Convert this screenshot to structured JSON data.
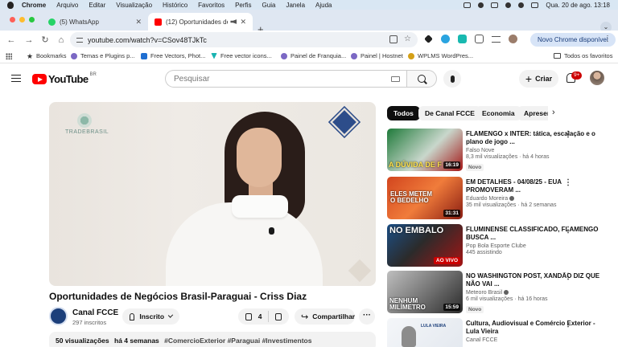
{
  "menubar": {
    "items": [
      "Chrome",
      "Arquivo",
      "Editar",
      "Visualização",
      "Histórico",
      "Favoritos",
      "Perfis",
      "Guia",
      "Janela",
      "Ajuda"
    ],
    "datetime": "Qua. 20 de ago.  13:18"
  },
  "tabs": [
    {
      "title": "(5) WhatsApp",
      "favicon_color": "#25d366"
    },
    {
      "title": "(12) Oportunidades de Ne",
      "favicon_color": "#ff0000"
    }
  ],
  "tabstrip": {
    "new_tab": "+",
    "menu": "⌄"
  },
  "toolbar": {
    "url": "youtube.com/watch?v=CSov48TJkTc",
    "new_chrome": "Novo Chrome disponível"
  },
  "bookmarks": {
    "items": [
      {
        "label": "Bookmarks",
        "color": "#555"
      },
      {
        "label": "Temas e Plugins p...",
        "color": "#7b68c4"
      },
      {
        "label": "Free Vectors, Phot...",
        "color": "#1f6fd1"
      },
      {
        "label": "Free vector icons...",
        "color": "#19b3b1"
      },
      {
        "label": "Painel de Franquia...",
        "color": "#7b68c4"
      },
      {
        "label": "Painel | Hostnet",
        "color": "#7b68c4"
      },
      {
        "label": "WPLMS WordPres...",
        "color": "#d4a017"
      }
    ],
    "all_favorites": "Todos os favoritos"
  },
  "youtube": {
    "logo": "YouTube",
    "region": "BR",
    "search_placeholder": "Pesquisar",
    "create_label": "Criar",
    "notif_badge": "9+"
  },
  "video": {
    "brand": "TRADEBRASIL",
    "title": "Oportunidades de Negócios Brasil-Paraguai - Criss Diaz",
    "channel": "Canal FCCE",
    "subscribers": "297 inscritos",
    "subscribed_label": "Inscrito",
    "likes": "4",
    "share_label": "Compartilhar",
    "more": "···",
    "views": "50 visualizações",
    "date": "há 4 semanas",
    "tags": "#ComercioExterior #Paraguai #Investimentos"
  },
  "chips": [
    "Todos",
    "De Canal FCCE",
    "Economia",
    "Apresen"
  ],
  "recommendations": [
    {
      "title": "FLAMENGO x INTER: tática, escalação e o plano de jogo ...",
      "channel": "Falso Nove",
      "meta": "8,3 mil visualizações · há 4 horas",
      "badge": "Novo",
      "duration": "16:19",
      "overlay": "A DÚVIDA DE F",
      "verified": false,
      "bg": "#1f7a3a"
    },
    {
      "title": "EM DETALHES - 04/08/25 - EUA PROMOVERAM ...",
      "channel": "Eduardo Moreira",
      "meta": "35 mil visualizações · há 2 semanas",
      "badge": "",
      "duration": "31:31",
      "overlay": "ELES METEM O BEDELHO",
      "verified": true,
      "bg": "#d2451e"
    },
    {
      "title": "FLUMINENSE CLASSIFICADO, FLAMENGO BUSCA ...",
      "channel": "Pop Bola Esporte Clube",
      "meta": "445 assistindo",
      "badge": "",
      "duration": "AO VIVO",
      "overlay": "NO EMBALO",
      "verified": false,
      "bg": "#2b2b2b",
      "live": true
    },
    {
      "title": "NO WASHINGTON POST, XANDÃO DIZ QUE NÃO VAI ...",
      "channel": "Meteoro Brasil",
      "meta": "6 mil visualizações · há 16 horas",
      "badge": "Novo",
      "duration": "15:59",
      "overlay": "NENHUM MILÍMETRO",
      "verified": true,
      "bg": "#6f6f6f"
    },
    {
      "title": "Cultura, Audiovisual e Comércio Exterior -  Lula Vieira",
      "channel": "Canal FCCE",
      "meta": "",
      "badge": "",
      "duration": "",
      "overlay": "LULA VIEIRA",
      "verified": false,
      "bg": "#e9edf3"
    }
  ]
}
